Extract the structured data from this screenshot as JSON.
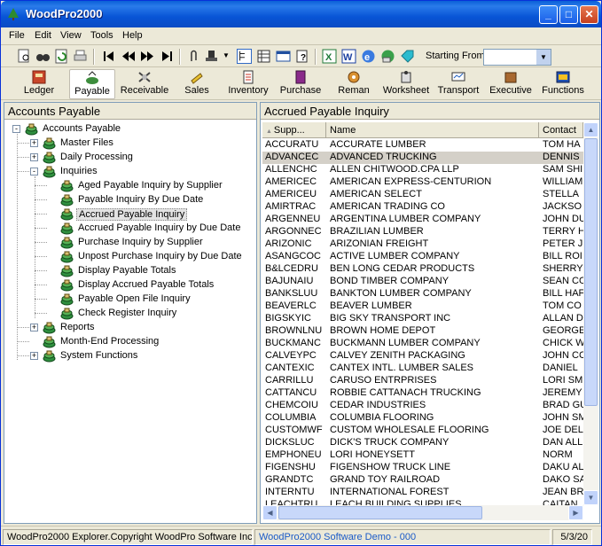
{
  "window": {
    "title": "WoodPro2000"
  },
  "menu": [
    "File",
    "Edit",
    "View",
    "Tools",
    "Help"
  ],
  "toolbar1": {
    "starting_from_label": "Starting From",
    "starting_from_value": ""
  },
  "nav": [
    "Ledger",
    "Payable",
    "Receivable",
    "Sales",
    "Inventory",
    "Purchase",
    "Reman",
    "Worksheet",
    "Transport",
    "Executive",
    "Functions"
  ],
  "left": {
    "header": "Accounts Payable",
    "tree": [
      {
        "label": "Accounts Payable"
      },
      {
        "label": "Master Files"
      },
      {
        "label": "Daily Processing"
      },
      {
        "label": "Inquiries"
      },
      {
        "label": "Aged Payable Inquiry by Supplier"
      },
      {
        "label": "Payable Inquiry By Due Date"
      },
      {
        "label": "Accrued Payable Inquiry"
      },
      {
        "label": "Accrued Payable Inquiry by Due Date"
      },
      {
        "label": "Purchase Inquiry by Supplier"
      },
      {
        "label": "Unpost Purchase Inquiry by Due Date"
      },
      {
        "label": "Display Payable Totals"
      },
      {
        "label": "Display Accrued Payable Totals"
      },
      {
        "label": "Payable Open File Inquiry"
      },
      {
        "label": "Check Register Inquiry"
      },
      {
        "label": "Reports"
      },
      {
        "label": "Month-End Processing"
      },
      {
        "label": "System Functions"
      }
    ]
  },
  "right": {
    "header": "Accrued Payable Inquiry",
    "columns": [
      "Supp...",
      "Name",
      "Contact"
    ],
    "rows": [
      [
        "ACCURATU",
        "ACCURATE LUMBER",
        "TOM HA"
      ],
      [
        "ADVANCEC",
        "ADVANCED TRUCKING",
        "DENNIS"
      ],
      [
        "ALLENCHC",
        "ALLEN CHITWOOD.CPA LLP",
        "SAM SHI"
      ],
      [
        "AMERICEC",
        "AMERICAN EXPRESS-CENTURION",
        "WILLIAM"
      ],
      [
        "AMERICEU",
        "AMERICAN SELECT",
        "STELLA"
      ],
      [
        "AMIRTRAC",
        "AMERICAN TRADING CO",
        "JACKSO"
      ],
      [
        "ARGENNEU",
        "ARGENTINA LUMBER COMPANY",
        "JOHN DU"
      ],
      [
        "ARGONNEC",
        "BRAZILIAN LUMBER",
        "TERRY H"
      ],
      [
        "ARIZONIC",
        "ARIZONIAN FREIGHT",
        "PETER J"
      ],
      [
        "ASANGCOC",
        "ACTIVE LUMBER COMPANY",
        "BILL ROI"
      ],
      [
        "B&LCEDRU",
        "BEN LONG CEDAR PRODUCTS",
        "SHERRY"
      ],
      [
        "BAJUNAIU",
        "BOND TIMBER COMPANY",
        "SEAN CO"
      ],
      [
        "BANKSLUU",
        "BANKTON LUMBER COMPANY",
        "BILL HAF"
      ],
      [
        "BEAVERLC",
        "BEAVER LUMBER",
        "TOM CO"
      ],
      [
        "BIGSKYIC",
        "BIG SKY TRANSPORT INC",
        "ALLAN D"
      ],
      [
        "BROWNLNU",
        "BROWN HOME DEPOT",
        "GEORGE"
      ],
      [
        "BUCKMANC",
        "BUCKMANN LUMBER COMPANY",
        "CHICK W"
      ],
      [
        "CALVEYPC",
        "CALVEY ZENITH PACKAGING",
        "JOHN CC"
      ],
      [
        "CANTEXIC",
        "CANTEX INTL. LUMBER SALES",
        "DANIEL"
      ],
      [
        "CARRILLU",
        "CARUSO ENTRPRISES",
        "LORI SM"
      ],
      [
        "CATTANCU",
        "ROBBIE CATTANACH TRUCKING",
        "JEREMY"
      ],
      [
        "CHEMCOIU",
        "CEDAR INDUSTRIES",
        "BRAD GU"
      ],
      [
        "COLUMBIA",
        "COLUMBIA FLOORING",
        "JOHN SM"
      ],
      [
        "CUSTOMWF",
        "CUSTOM WHOLESALE FLOORING",
        "JOE DEL"
      ],
      [
        "DICKSLUC",
        "DICK'S TRUCK COMPANY",
        "DAN ALL"
      ],
      [
        "EMPHONEU",
        "LORI HONEYSETT",
        "NORM"
      ],
      [
        "FIGENSHU",
        "FIGENSHOW TRUCK LINE",
        "DAKU AL"
      ],
      [
        "GRANDTC",
        "GRAND TOY RAILROAD",
        "DAKO SA"
      ],
      [
        "INTERNTU",
        "INTERNATIONAL FOREST",
        "JEAN BR"
      ],
      [
        "LEACHTRU",
        "LEACH BUILDING SUPPLIES",
        "CAITAN"
      ]
    ],
    "selected_row": 1
  },
  "status": {
    "left": "WoodPro2000 Explorer.Copyright  WoodPro Software Inc.",
    "middle": "WoodPro2000 Software Demo - 000",
    "right": "5/3/20"
  }
}
